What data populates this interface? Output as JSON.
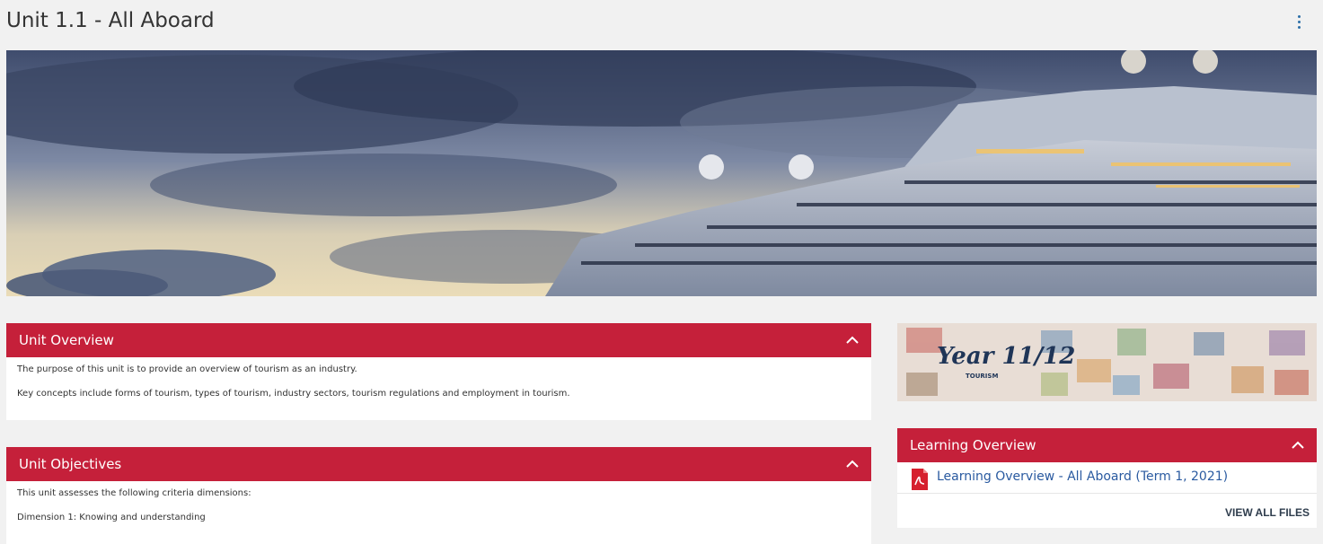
{
  "page": {
    "title": "Unit 1.1 - All Aboard"
  },
  "overview": {
    "title": "Unit Overview",
    "paragraphs": [
      "The purpose of this unit is to provide an overview of tourism as an industry.",
      "Key concepts include forms of tourism, types of tourism, industry sectors, tourism regulations and employment in tourism."
    ]
  },
  "objectives": {
    "title": "Unit Objectives",
    "paragraphs": [
      "This unit assesses the following criteria dimensions:",
      "Dimension 1: Knowing and understanding"
    ]
  },
  "year_tile": {
    "title": "Year 11/12",
    "subtitle": "TOURISM"
  },
  "learning": {
    "title": "Learning Overview",
    "file_label": "Learning Overview - All Aboard (Term 1, 2021)",
    "view_all": "VIEW ALL FILES"
  },
  "icons": {
    "menu": "more-vertical-icon",
    "collapse": "chevron-up-icon",
    "file": "pdf-icon"
  },
  "colors": {
    "accent": "#c5203a",
    "link": "#2a5aa0",
    "background": "#f1f1f1"
  }
}
